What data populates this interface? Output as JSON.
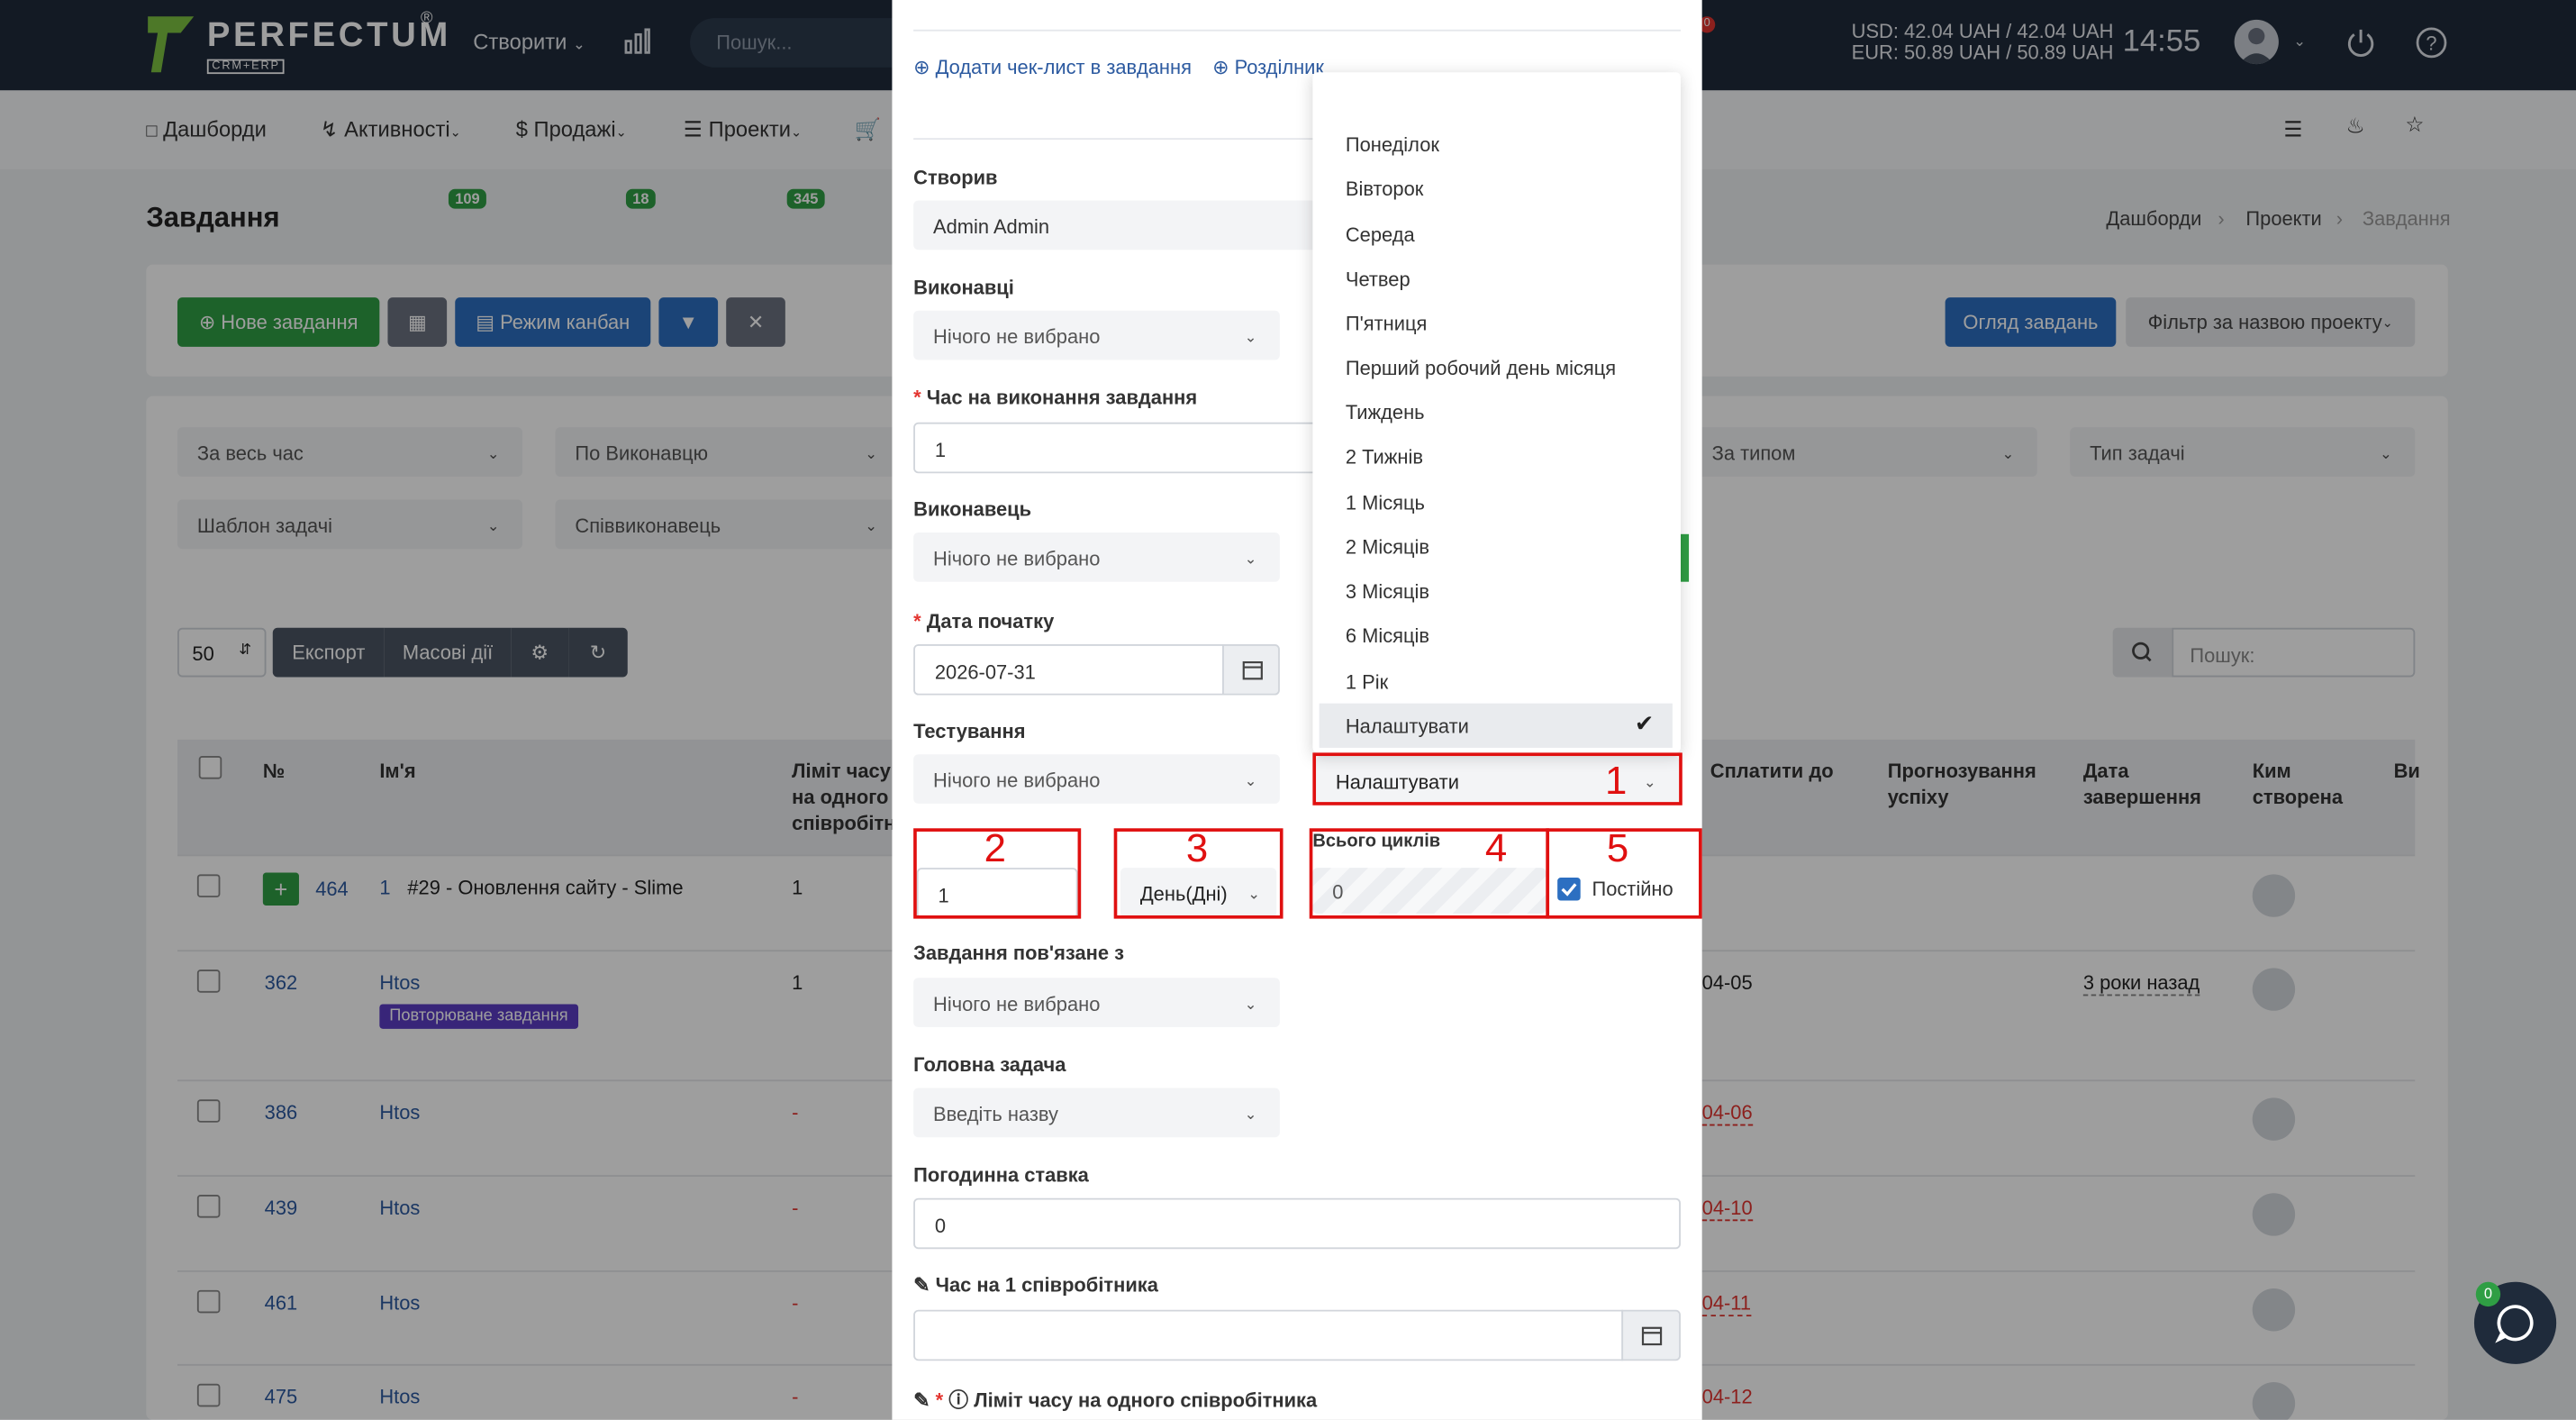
{
  "topbar": {
    "logo_text": "PERFECTUM",
    "logo_sub": "CRM+ERP",
    "logo_reg": "®",
    "create_label": "Створити",
    "search_placeholder": "Пошук...",
    "notification_count": "0",
    "usd_rate": "USD: 42.04 UAH / 42.04 UAH",
    "eur_rate": "EUR: 50.89 UAH / 50.89 UAH",
    "time": "14:55"
  },
  "navbar": {
    "items": [
      {
        "label": "Дашборди"
      },
      {
        "label": "Активності",
        "badge": "109"
      },
      {
        "label": "Продажі",
        "badge": "18"
      },
      {
        "label": "Проекти",
        "badge": "345"
      }
    ]
  },
  "page": {
    "title": "Завдання",
    "breadcrumbs": [
      "Дашборди",
      "Проекти",
      "Завдання"
    ],
    "new_task_label": "Нове завдання",
    "kanban_label": "Режим канбан",
    "overview_label": "Огляд завдань",
    "project_filter_label": "Фільтр за назвою проекту",
    "filters": [
      "За весь час",
      "По Виконавцю",
      "За типом",
      "Тип задачі",
      "Шаблон задачі",
      "Співвиконавець"
    ],
    "page_size": "50",
    "export_label": "Експорт",
    "bulk_label": "Масові дії",
    "search_placeholder": "Пошук:"
  },
  "table": {
    "headers": [
      "№",
      "Ім'я",
      "Ліміт часу на одного співробітника",
      "Сплатити до",
      "Прогнозування успіху",
      "Дата завершення",
      "Ким створена",
      "Ви"
    ],
    "rows": [
      {
        "id": "464",
        "name": "1",
        "name_extra": "#29 - Оновлення сайту - Slime",
        "limit": "1",
        "pay": "",
        "done": "",
        "tag": ""
      },
      {
        "id": "362",
        "name": "Htos",
        "name_extra": "",
        "limit": "1",
        "pay": "04-05",
        "done": "3 роки назад",
        "tag": "Повторюване завдання"
      },
      {
        "id": "386",
        "name": "Htos",
        "name_extra": "",
        "limit": "-",
        "pay": "04-06",
        "done": "",
        "tag": ""
      },
      {
        "id": "439",
        "name": "Htos",
        "name_extra": "",
        "limit": "-",
        "pay": "04-10",
        "done": "",
        "tag": ""
      },
      {
        "id": "461",
        "name": "Htos",
        "name_extra": "",
        "limit": "-",
        "pay": "04-11",
        "done": "",
        "tag": ""
      },
      {
        "id": "475",
        "name": "Htos",
        "name_extra": "",
        "limit": "-",
        "pay": "04-12",
        "done": "",
        "tag": ""
      }
    ]
  },
  "modal": {
    "add_checklist": "Додати чек-лист в завдання",
    "separator": "Розділник",
    "created_by_label": "Створив",
    "created_by_value": "Admin Admin",
    "executors_label": "Виконавці",
    "nothing_selected": "Нічого не вибрано",
    "time_label": "Час на виконання завдання",
    "time_value": "1",
    "executor_label": "Виконавець",
    "start_date_label": "Дата початку",
    "start_date_value": "2026-07-31",
    "testing_label": "Тестування",
    "repeat_value": "Налаштувати",
    "interval_value": "1",
    "unit_value": "День(Дні)",
    "cycles_label": "Всього циклів",
    "cycles_value": "0",
    "permanent_label": "Постійно",
    "related_label": "Завдання пов'язане з",
    "parent_label": "Головна задача",
    "parent_placeholder": "Введіть назву",
    "hourly_label": "Погодинна ставка",
    "hourly_value": "0",
    "per_employee_label": "Час на 1 співробітника",
    "limit_label": "Ліміт часу на одного співробітника"
  },
  "dropdown": {
    "options": [
      "Понеділок",
      "Вівторок",
      "Середа",
      "Четвер",
      "П'ятниця",
      "Перший робочий день місяця",
      "Тиждень",
      "2 Тижнів",
      "1 Місяць",
      "2 Місяців",
      "3 Місяців",
      "6 Місяців",
      "1 Рік",
      "Налаштувати"
    ],
    "selected": "Налаштувати"
  },
  "annotations": [
    "1",
    "2",
    "3",
    "4",
    "5"
  ],
  "chat_badge": "0",
  "colors": {
    "topbar": "#1f2b3b",
    "green": "#2f9e44",
    "blue": "#2c5aa0",
    "annotation": "#e01010"
  }
}
